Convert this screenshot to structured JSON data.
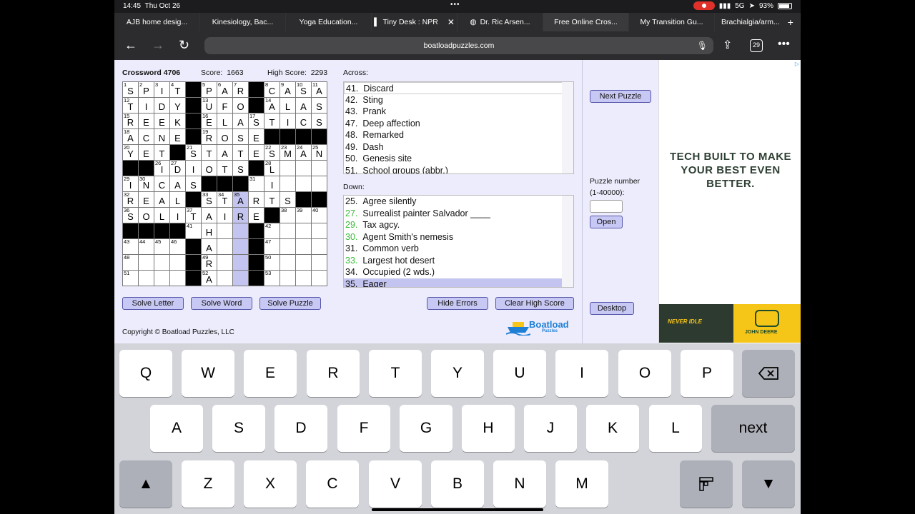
{
  "status_bar": {
    "time": "14:45",
    "date": "Thu Oct 26",
    "network": "5G",
    "battery": "93%"
  },
  "tabs": [
    {
      "label": "AJB home desig...",
      "icon": ""
    },
    {
      "label": "Kinesiology, Bac...",
      "icon": ""
    },
    {
      "label": "Yoga Education...",
      "icon": ""
    },
    {
      "label": "Tiny Desk : NPR",
      "icon": "npr-icon"
    },
    {
      "label": "Dr. Ric Arsen...",
      "icon": "globe-icon"
    },
    {
      "label": "Free Online Cros...",
      "icon": ""
    },
    {
      "label": "My Transition Gu...",
      "icon": ""
    },
    {
      "label": "Brachialgia/arm...",
      "icon": ""
    }
  ],
  "url": "boatloadpuzzles.com",
  "tab_count": "29",
  "puzzle": {
    "title": "Crossword 4706",
    "score_label": "Score:",
    "score": "1663",
    "high_score_label": "High Score:",
    "high_score": "2293",
    "grid": [
      [
        {
          "n": "1",
          "l": "S"
        },
        {
          "n": "2",
          "l": "P"
        },
        {
          "n": "3",
          "l": "I"
        },
        {
          "n": "4",
          "l": "T"
        },
        null,
        {
          "n": "5",
          "l": "P"
        },
        {
          "n": "6",
          "l": "A"
        },
        {
          "n": "7",
          "l": "R"
        },
        null,
        {
          "n": "8",
          "l": "C"
        },
        {
          "n": "9",
          "l": "A"
        },
        {
          "n": "10",
          "l": "S"
        },
        {
          "n": "11",
          "l": "A"
        }
      ],
      [
        {
          "n": "12",
          "l": "T"
        },
        {
          "l": "I"
        },
        {
          "l": "D"
        },
        {
          "l": "Y"
        },
        null,
        {
          "n": "13",
          "l": "U"
        },
        {
          "l": "F"
        },
        {
          "l": "O"
        },
        null,
        {
          "n": "14",
          "l": "A"
        },
        {
          "l": "L"
        },
        {
          "l": "A"
        },
        {
          "l": "S"
        }
      ],
      [
        {
          "n": "15",
          "l": "R"
        },
        {
          "l": "E"
        },
        {
          "l": "E"
        },
        {
          "l": "K"
        },
        null,
        {
          "n": "16",
          "l": "E"
        },
        {
          "l": "L"
        },
        {
          "l": "A"
        },
        {
          "n": "17",
          "l": "S"
        },
        {
          "l": "T"
        },
        {
          "l": "I"
        },
        {
          "l": "C"
        },
        {
          "l": "S"
        }
      ],
      [
        {
          "n": "18",
          "l": "A"
        },
        {
          "l": "C"
        },
        {
          "l": "N"
        },
        {
          "l": "E"
        },
        null,
        {
          "n": "19",
          "l": "R"
        },
        {
          "l": "O"
        },
        {
          "l": "S"
        },
        {
          "l": "E"
        },
        null,
        null,
        null,
        null
      ],
      [
        {
          "n": "20",
          "l": "Y"
        },
        {
          "l": "E"
        },
        {
          "l": "T"
        },
        null,
        {
          "n": "21",
          "l": "S"
        },
        {
          "l": "T"
        },
        {
          "l": "A"
        },
        {
          "l": "T"
        },
        {
          "l": "E"
        },
        {
          "n": "22",
          "l": "S"
        },
        {
          "n": "23",
          "l": "M"
        },
        {
          "n": "24",
          "l": "A"
        },
        {
          "n": "25",
          "l": "N"
        }
      ],
      [
        null,
        null,
        {
          "n": "26",
          "l": "I"
        },
        {
          "n": "27",
          "l": "D"
        },
        {
          "l": "I"
        },
        {
          "l": "O"
        },
        {
          "l": "T"
        },
        {
          "l": "S"
        },
        null,
        {
          "n": "28",
          "l": "L"
        },
        {
          "l": ""
        },
        {
          "l": ""
        },
        {
          "l": ""
        }
      ],
      [
        {
          "n": "29",
          "l": "I"
        },
        {
          "n": "30",
          "l": "N"
        },
        {
          "l": "C"
        },
        {
          "l": "A"
        },
        {
          "l": "S"
        },
        null,
        null,
        null,
        {
          "n": "31",
          "l": ""
        },
        {
          "l": "I"
        },
        {
          "l": ""
        },
        {
          "l": ""
        },
        {
          "l": ""
        }
      ],
      [
        {
          "n": "32",
          "l": "R"
        },
        {
          "l": "E"
        },
        {
          "l": "A"
        },
        {
          "l": "L"
        },
        null,
        {
          "n": "33",
          "l": "S"
        },
        {
          "n": "34",
          "l": "T"
        },
        {
          "n": "35",
          "l": "A",
          "hl": true
        },
        {
          "l": "R"
        },
        {
          "l": "T"
        },
        {
          "l": "S"
        },
        null,
        null
      ],
      [
        {
          "n": "36",
          "l": "S"
        },
        {
          "l": "O"
        },
        {
          "l": "L"
        },
        {
          "l": "I"
        },
        {
          "n": "37",
          "l": "T"
        },
        {
          "l": "A"
        },
        {
          "l": "I"
        },
        {
          "l": "R",
          "hl": true
        },
        {
          "l": "E"
        },
        null,
        {
          "n": "38",
          "l": ""
        },
        {
          "n": "39",
          "l": ""
        },
        {
          "n": "40",
          "l": ""
        }
      ],
      [
        null,
        null,
        null,
        null,
        {
          "n": "41",
          "l": ""
        },
        {
          "l": "H"
        },
        {
          "l": ""
        },
        {
          "l": "",
          "hl": true
        },
        null,
        {
          "n": "42",
          "l": ""
        },
        {
          "l": ""
        },
        {
          "l": ""
        },
        {
          "l": ""
        }
      ],
      [
        {
          "n": "43",
          "l": ""
        },
        {
          "n": "44",
          "l": ""
        },
        {
          "n": "45",
          "l": ""
        },
        {
          "n": "46",
          "l": ""
        },
        null,
        {
          "l": "A"
        },
        {
          "l": ""
        },
        {
          "l": "",
          "hl": true
        },
        null,
        {
          "n": "47",
          "l": ""
        },
        {
          "l": ""
        },
        {
          "l": ""
        },
        {
          "l": ""
        }
      ],
      [
        {
          "n": "48",
          "l": ""
        },
        {
          "l": ""
        },
        {
          "l": ""
        },
        {
          "l": ""
        },
        null,
        {
          "n": "49",
          "l": "R"
        },
        {
          "l": ""
        },
        {
          "l": "",
          "hl": true
        },
        null,
        {
          "n": "50",
          "l": ""
        },
        {
          "l": ""
        },
        {
          "l": ""
        },
        {
          "l": ""
        }
      ],
      [
        {
          "n": "51",
          "l": ""
        },
        {
          "l": ""
        },
        {
          "l": ""
        },
        {
          "l": ""
        },
        null,
        {
          "n": "52",
          "l": "A"
        },
        {
          "l": ""
        },
        {
          "l": "",
          "hl": true
        },
        null,
        {
          "n": "53",
          "l": ""
        },
        {
          "l": ""
        },
        {
          "l": ""
        },
        {
          "l": ""
        }
      ]
    ],
    "across_label": "Across:",
    "across": [
      {
        "num": "41.",
        "text": "Discard"
      },
      {
        "num": "42.",
        "text": "Sting"
      },
      {
        "num": "43.",
        "text": "Prank"
      },
      {
        "num": "47.",
        "text": "Deep affection"
      },
      {
        "num": "48.",
        "text": "Remarked"
      },
      {
        "num": "49.",
        "text": "Dash"
      },
      {
        "num": "50.",
        "text": "Genesis site"
      },
      {
        "num": "51.",
        "text": "School groups (abbr.)"
      }
    ],
    "down_label": "Down:",
    "down": [
      {
        "num": "25.",
        "text": "Agree silently",
        "done": false
      },
      {
        "num": "27.",
        "text": "Surrealist painter Salvador ____",
        "done": true
      },
      {
        "num": "29.",
        "text": "Tax agcy.",
        "done": true
      },
      {
        "num": "30.",
        "text": "Agent Smith's nemesis",
        "done": true
      },
      {
        "num": "31.",
        "text": "Common verb",
        "done": false
      },
      {
        "num": "33.",
        "text": "Largest hot desert",
        "done": true
      },
      {
        "num": "34.",
        "text": "Occupied (2 wds.)",
        "done": false
      },
      {
        "num": "35.",
        "text": "Eager",
        "done": false,
        "selected": true
      }
    ],
    "buttons": {
      "solve_letter": "Solve Letter",
      "solve_word": "Solve Word",
      "solve_puzzle": "Solve Puzzle",
      "hide_errors": "Hide Errors",
      "clear_high_score": "Clear High Score"
    },
    "copyright": "Copyright © Boatload Puzzles, LLC",
    "logo_text": "Boatload",
    "logo_sub": "Puzzles"
  },
  "sidebar": {
    "next_puzzle": "Next Puzzle",
    "puzzle_number_label": "Puzzle number",
    "puzzle_number_range": "(1-40000):",
    "open": "Open",
    "desktop": "Desktop"
  },
  "ad": {
    "headline": "TECH BUILT TO MAKE YOUR BEST EVEN BETTER.",
    "tagline": "NEVER IDLE",
    "brand": "JOHN DEERE"
  },
  "keyboard": {
    "row1": [
      "Q",
      "W",
      "E",
      "R",
      "T",
      "Y",
      "U",
      "I",
      "O",
      "P"
    ],
    "row2": [
      "A",
      "S",
      "D",
      "F",
      "G",
      "H",
      "J",
      "K",
      "L"
    ],
    "row3": [
      "Z",
      "X",
      "C",
      "V",
      "B",
      "N",
      "M"
    ],
    "next_label": "next"
  }
}
